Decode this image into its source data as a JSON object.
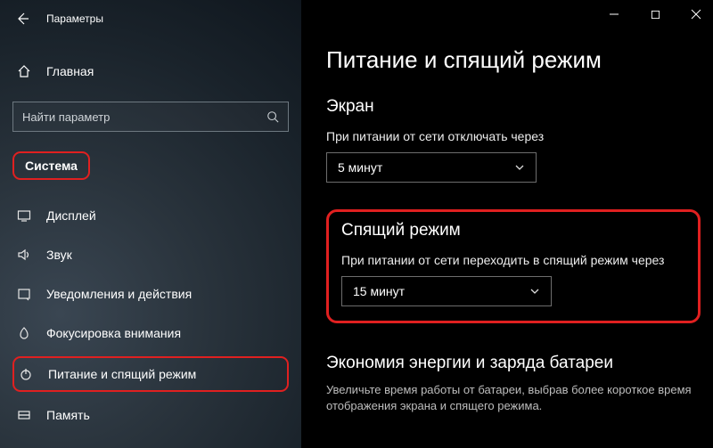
{
  "window": {
    "title": "Параметры",
    "buttons": {
      "minimize": "—",
      "maximize": "□",
      "close": "✕"
    }
  },
  "sidebar": {
    "home_label": "Главная",
    "search_placeholder": "Найти параметр",
    "category_label": "Система",
    "items": [
      {
        "icon": "display-icon",
        "label": "Дисплей",
        "active": false
      },
      {
        "icon": "sound-icon",
        "label": "Звук",
        "active": false
      },
      {
        "icon": "notify-icon",
        "label": "Уведомления и действия",
        "active": false
      },
      {
        "icon": "focus-icon",
        "label": "Фокусировка внимания",
        "active": false
      },
      {
        "icon": "power-icon",
        "label": "Питание и спящий режим",
        "active": true
      },
      {
        "icon": "storage-icon",
        "label": "Память",
        "active": false
      }
    ]
  },
  "content": {
    "page_title": "Питание и спящий режим",
    "screen": {
      "heading": "Экран",
      "subtext": "При питании от сети отключать через",
      "dropdown_value": "5 минут"
    },
    "sleep": {
      "heading": "Спящий режим",
      "subtext": "При питании от сети переходить в спящий режим через",
      "dropdown_value": "15 минут"
    },
    "battery": {
      "heading": "Экономия энергии и заряда батареи",
      "subtext": "Увеличьте время работы от батареи, выбрав более короткое время отображения экрана и спящего режима."
    }
  }
}
